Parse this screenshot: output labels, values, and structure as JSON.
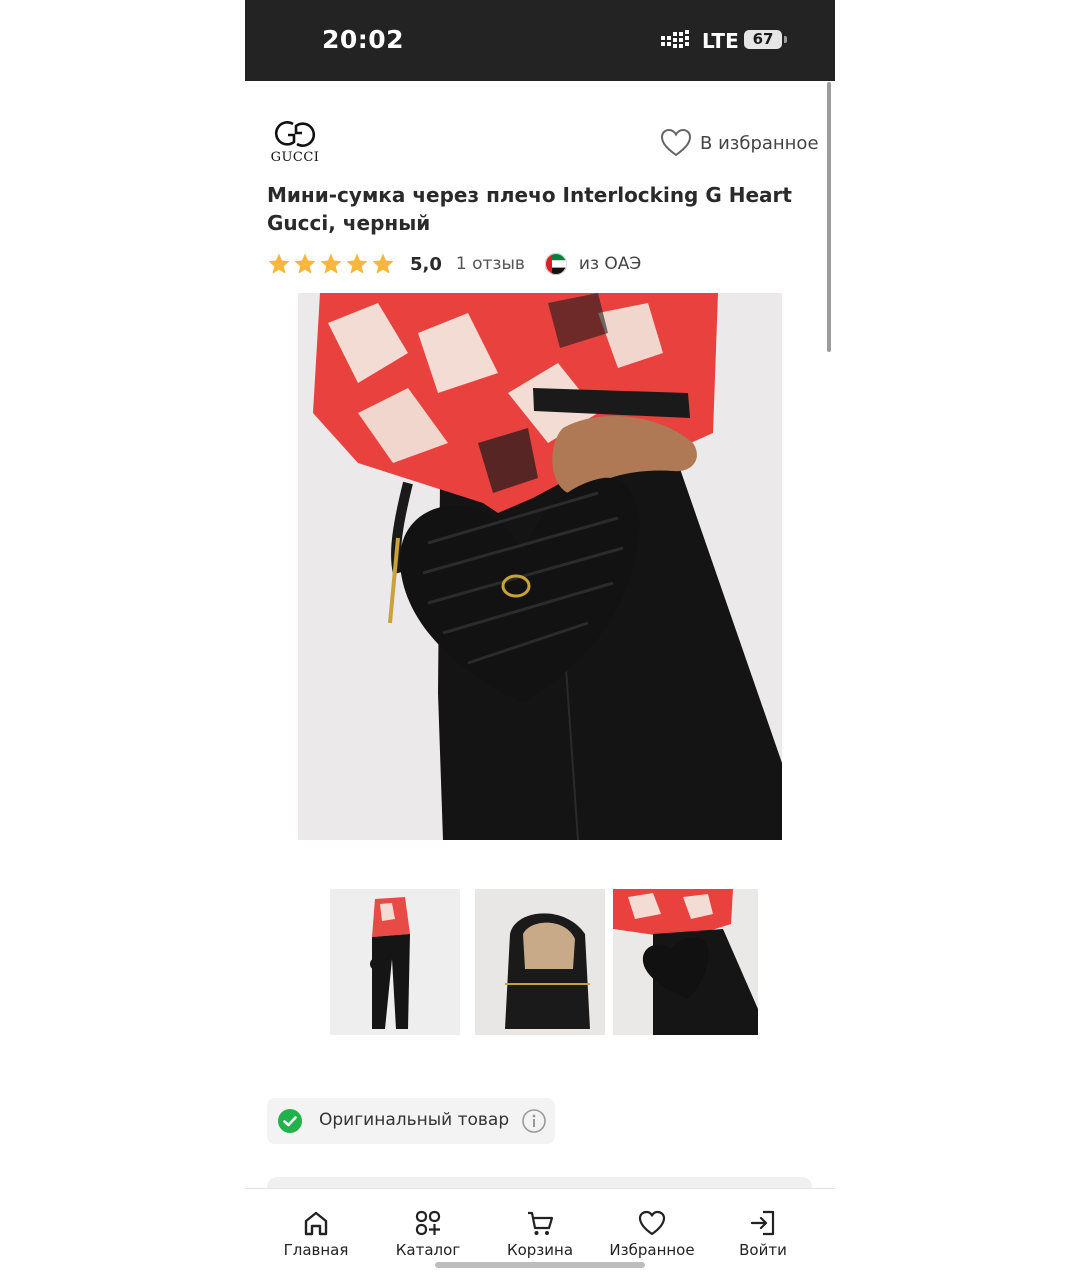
{
  "status_bar": {
    "time": "20:02",
    "network": "LTE",
    "battery": "67"
  },
  "brand": {
    "name": "GUCCI"
  },
  "favorite": {
    "label": "В избранное"
  },
  "product": {
    "title": "Мини-сумка через плечо Interlocking G Heart Gucci, черный",
    "rating": "5,0",
    "stars": 5,
    "reviews": "1 отзыв",
    "origin": "из ОАЭ"
  },
  "images": {
    "thumbnail_count": 3,
    "selected_thumbnail": 3
  },
  "badge": {
    "label": "Оригинальный товар"
  },
  "bottom_nav": {
    "items": [
      {
        "label": "Главная",
        "icon": "home-icon"
      },
      {
        "label": "Каталог",
        "icon": "catalog-icon"
      },
      {
        "label": "Корзина",
        "icon": "cart-icon"
      },
      {
        "label": "Избранное",
        "icon": "heart-icon"
      },
      {
        "label": "Войти",
        "icon": "login-icon"
      }
    ]
  },
  "colors": {
    "star": "#f6b73c",
    "check": "#21b24b",
    "status_bar": "#232323"
  }
}
